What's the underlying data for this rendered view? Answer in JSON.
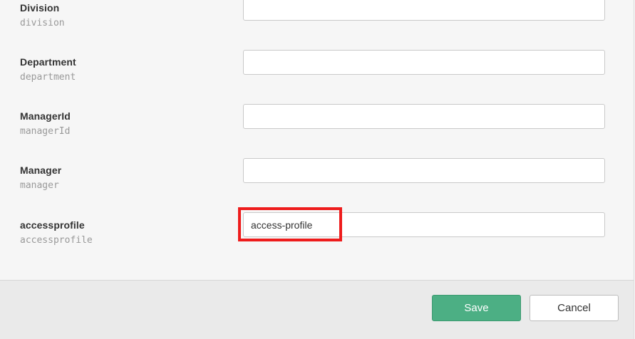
{
  "fields": [
    {
      "label": "Division",
      "key": "division",
      "value": ""
    },
    {
      "label": "Department",
      "key": "department",
      "value": ""
    },
    {
      "label": "ManagerId",
      "key": "managerId",
      "value": ""
    },
    {
      "label": "Manager",
      "key": "manager",
      "value": ""
    },
    {
      "label": "accessprofile",
      "key": "accessprofile",
      "value": "access-profile"
    }
  ],
  "actions": {
    "save_label": "Save",
    "cancel_label": "Cancel"
  },
  "colors": {
    "save_bg": "#4caf84",
    "highlight": "#ee1c1c"
  }
}
